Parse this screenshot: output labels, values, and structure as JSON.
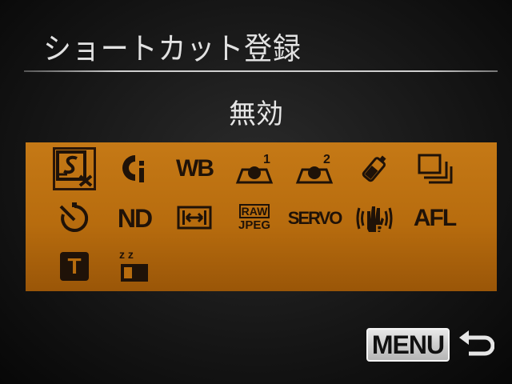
{
  "screen": {
    "title": "ショートカット登録",
    "current_value": "無効"
  },
  "colors": {
    "panel": "#b76c0e",
    "icon": "#1f1208",
    "text": "#e2e2e2"
  },
  "icons": [
    {
      "name": "disable-shortcut-icon",
      "label": ""
    },
    {
      "name": "i-contrast-icon",
      "label": ""
    },
    {
      "name": "white-balance-icon",
      "label": "WB"
    },
    {
      "name": "custom-white-balance-1-icon",
      "label": ""
    },
    {
      "name": "custom-white-balance-2-icon",
      "label": ""
    },
    {
      "name": "red-eye-correction-icon",
      "label": ""
    },
    {
      "name": "aspect-ratio-icon",
      "label": ""
    },
    {
      "name": "self-timer-icon",
      "label": ""
    },
    {
      "name": "nd-filter-icon",
      "label": "ND"
    },
    {
      "name": "display-width-icon",
      "label": ""
    },
    {
      "name": "raw-jpeg-icon",
      "label_top": "RAW",
      "label_bottom": "JPEG"
    },
    {
      "name": "servo-af-icon",
      "label": "SERVO"
    },
    {
      "name": "image-stabilizer-icon",
      "label": ""
    },
    {
      "name": "af-lock-icon",
      "label": "AFL"
    },
    {
      "name": "tv-mode-icon",
      "label": "T"
    },
    {
      "name": "display-off-icon",
      "label": "z z"
    }
  ],
  "footer": {
    "menu_label": "MENU",
    "return_icon": "return-icon"
  }
}
